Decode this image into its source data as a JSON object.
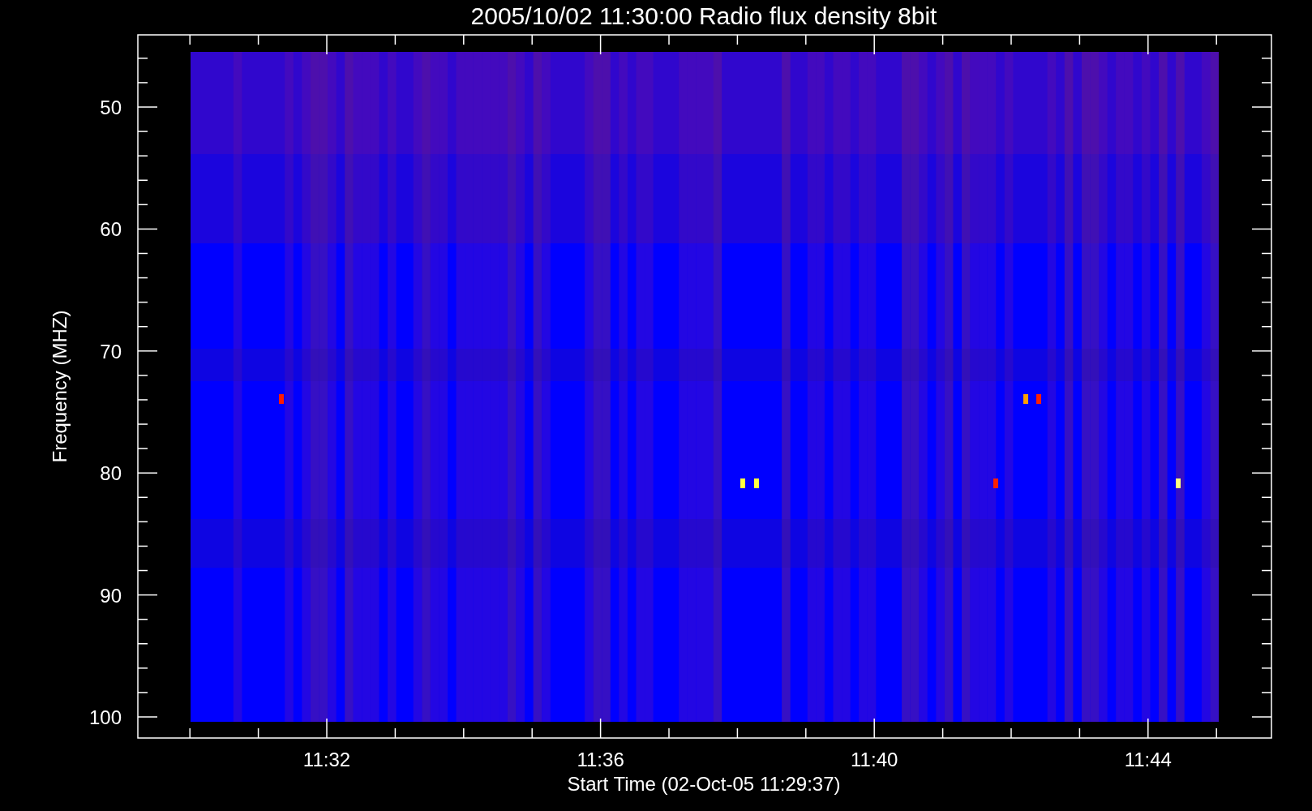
{
  "title": "2005/10/02 11:30:00 Radio flux density 8bit",
  "y_axis": {
    "label": "Frequency (MHZ)",
    "ticks": [
      "50",
      "60",
      "70",
      "80",
      "90",
      "100"
    ]
  },
  "x_axis": {
    "label": "Start Time (02-Oct-05 11:29:37)",
    "ticks": [
      "11:32",
      "11:36",
      "11:40",
      "11:44"
    ]
  }
}
